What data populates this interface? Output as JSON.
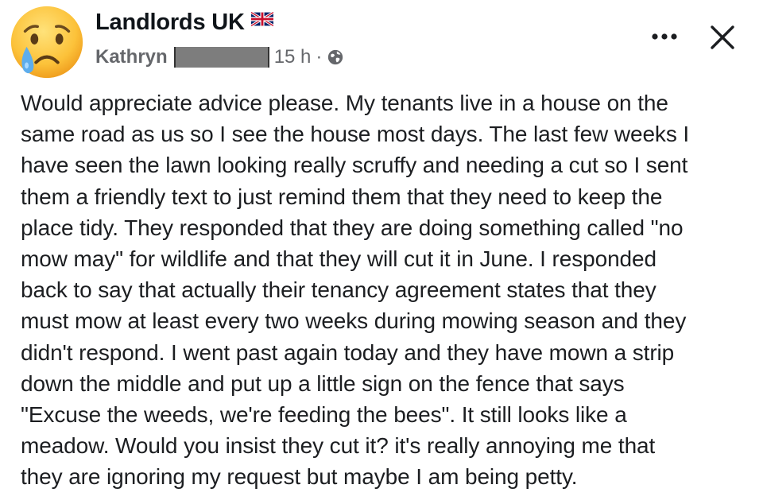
{
  "post": {
    "group_name": "Landlords UK",
    "author": "Kathryn",
    "time": "15 h",
    "separator": "·",
    "body": "Would appreciate advice please. My tenants live in a house on the\nsame road as us so I see the house most days. The last few weeks I\nhave seen the lawn looking really scruffy and needing a cut so I sent\nthem a friendly text to just remind them that they need to keep the\nplace tidy. They responded that they are doing something called \"no\nmow may\" for wildlife and that they will cut it in June. I responded\nback to say that actually their tenancy agreement states that they\nmust mow at least every two weeks during mowing season and they\ndidn't respond. I went past again today and they have mown a strip\ndown the middle and put up a little sign on the fence that says\n\"Excuse the weeds, we're feeding the bees\". It still looks like a\nmeadow. Would you insist they cut it? it's really annoying me that\nthey are ignoring my request but maybe I am being petty."
  },
  "icons": {
    "avatar": "crying-face-emoji-icon",
    "flag": "uk-flag-icon",
    "privacy": "globe-icon",
    "more": "more-options-icon",
    "close": "close-icon"
  },
  "colors": {
    "text": "#1c1e21",
    "secondary_text": "#65676b",
    "emoji_yellow": "#ffcc4d",
    "tear_blue": "#5dadec"
  }
}
